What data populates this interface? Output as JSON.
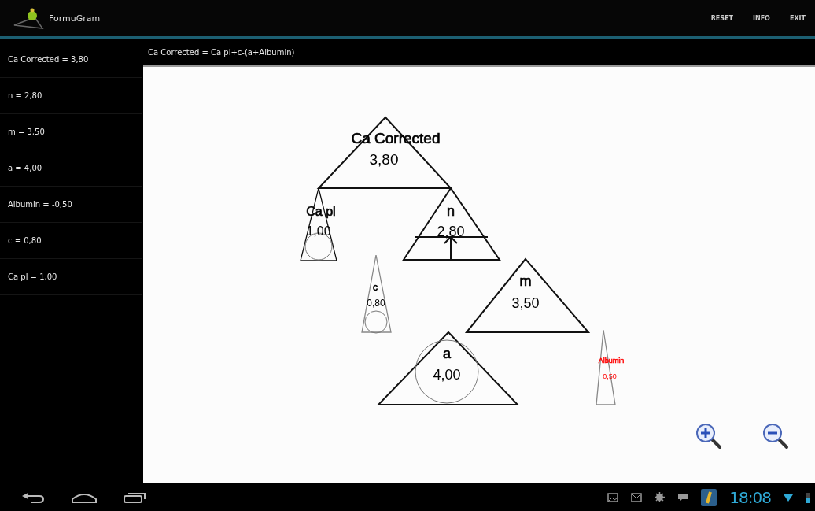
{
  "app_bar": {
    "title": "FormuGram",
    "actions": [
      "RESET",
      "INFO",
      "EXIT"
    ]
  },
  "sidebar": {
    "items": [
      {
        "label": "Ca Corrected = 3,80"
      },
      {
        "label": "n = 2,80"
      },
      {
        "label": "m = 3,50"
      },
      {
        "label": "a = 4,00"
      },
      {
        "label": "Albumin = -0,50"
      },
      {
        "label": "c = 0,80"
      },
      {
        "label": "Ca pl = 1,00"
      }
    ]
  },
  "formula": "Ca Corrected = Ca pl+c-(a+Albumin)",
  "diagram": {
    "nodes": [
      {
        "kind": "wide",
        "label": "Ca Corrected",
        "value": "3,80",
        "color": "#000000"
      },
      {
        "kind": "thin",
        "label": "Ca pl",
        "value": "1,00",
        "color": "#000000"
      },
      {
        "kind": "wide",
        "label": "n",
        "value": "2,80",
        "color": "#000000"
      },
      {
        "kind": "thin",
        "label": "c",
        "value": "0,80",
        "color": "#000000"
      },
      {
        "kind": "wide",
        "label": "m",
        "value": "3,50",
        "color": "#000000"
      },
      {
        "kind": "wide",
        "label": "a",
        "value": "4,00",
        "color": "#000000"
      },
      {
        "kind": "thin",
        "label": "Albumin",
        "value": "0,50",
        "color": "#ff0000"
      }
    ]
  },
  "status_bar": {
    "time": "18:08"
  }
}
